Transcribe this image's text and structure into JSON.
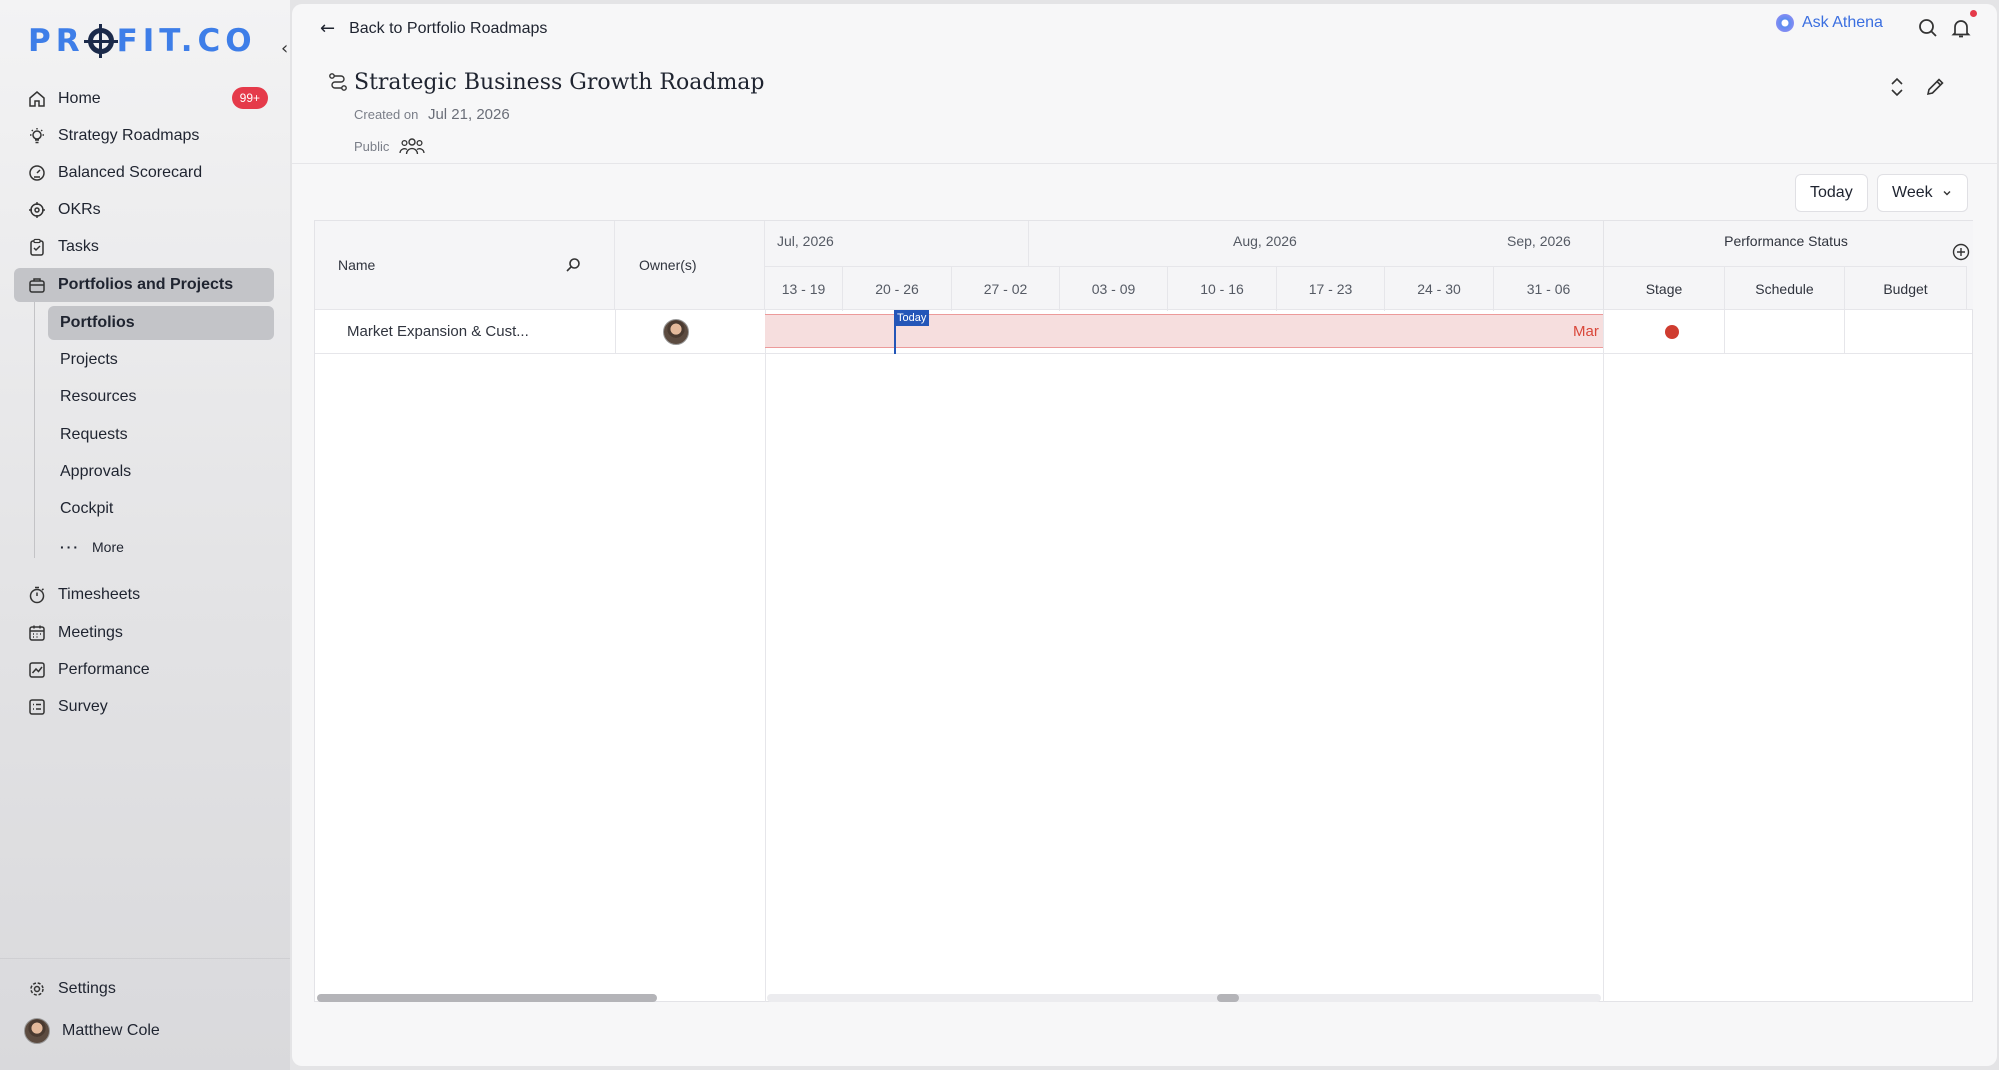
{
  "app": {
    "logo_text_left": "PR",
    "logo_text_right": "FIT.CO"
  },
  "sidebar": {
    "collapse_glyph": "‹",
    "items": [
      {
        "label": "Home",
        "icon": "home-icon",
        "badge": "99+"
      },
      {
        "label": "Strategy Roadmaps",
        "icon": "lightbulb-icon"
      },
      {
        "label": "Balanced Scorecard",
        "icon": "gauge-icon"
      },
      {
        "label": "OKRs",
        "icon": "target-icon"
      },
      {
        "label": "Tasks",
        "icon": "clipboard-icon"
      },
      {
        "label": "Portfolios and Projects",
        "icon": "briefcase-icon",
        "active": true
      }
    ],
    "sub_items": [
      {
        "label": "Portfolios",
        "active": true
      },
      {
        "label": "Projects"
      },
      {
        "label": "Resources"
      },
      {
        "label": "Requests"
      },
      {
        "label": "Approvals"
      },
      {
        "label": "Cockpit"
      },
      {
        "label": "More",
        "icon": "ellipsis-icon"
      }
    ],
    "lower_items": [
      {
        "label": "Timesheets",
        "icon": "stopwatch-icon"
      },
      {
        "label": "Meetings",
        "icon": "calendar-icon"
      },
      {
        "label": "Performance",
        "icon": "chart-icon"
      },
      {
        "label": "Survey",
        "icon": "survey-icon"
      }
    ],
    "settings_label": "Settings",
    "user_name": "Matthew Cole"
  },
  "topbar": {
    "back_label": "Back to Portfolio Roadmaps",
    "ask_label": "Ask Athena"
  },
  "header": {
    "title": "Strategic Business Growth Roadmap",
    "created_label": "Created on",
    "created_date": "Jul 21, 2026",
    "visibility": "Public"
  },
  "toolbar": {
    "today_label": "Today",
    "view_label": "Week"
  },
  "grid": {
    "name_header": "Name",
    "owner_header": "Owner(s)",
    "months": [
      "Jul, 2026",
      "Aug, 2026",
      "Sep, 2026"
    ],
    "weeks": [
      "13 - 19",
      "20 - 26",
      "27 - 02",
      "03 - 09",
      "10 - 16",
      "17 - 23",
      "24 - 30",
      "31 - 06"
    ],
    "performance_header": "Performance Status",
    "perf_columns": [
      "Stage",
      "Schedule",
      "Budget"
    ],
    "rows": [
      {
        "name": "Market Expansion & Cust...",
        "bar_label": "Mar",
        "stage_color": "#cf3c30"
      }
    ],
    "today_flag": "Today"
  },
  "colors": {
    "accent": "#3b6fe0",
    "today": "#2456b8",
    "bar_fill": "#f6dede",
    "bar_text": "#d9473a",
    "badge": "#e53a4a"
  }
}
